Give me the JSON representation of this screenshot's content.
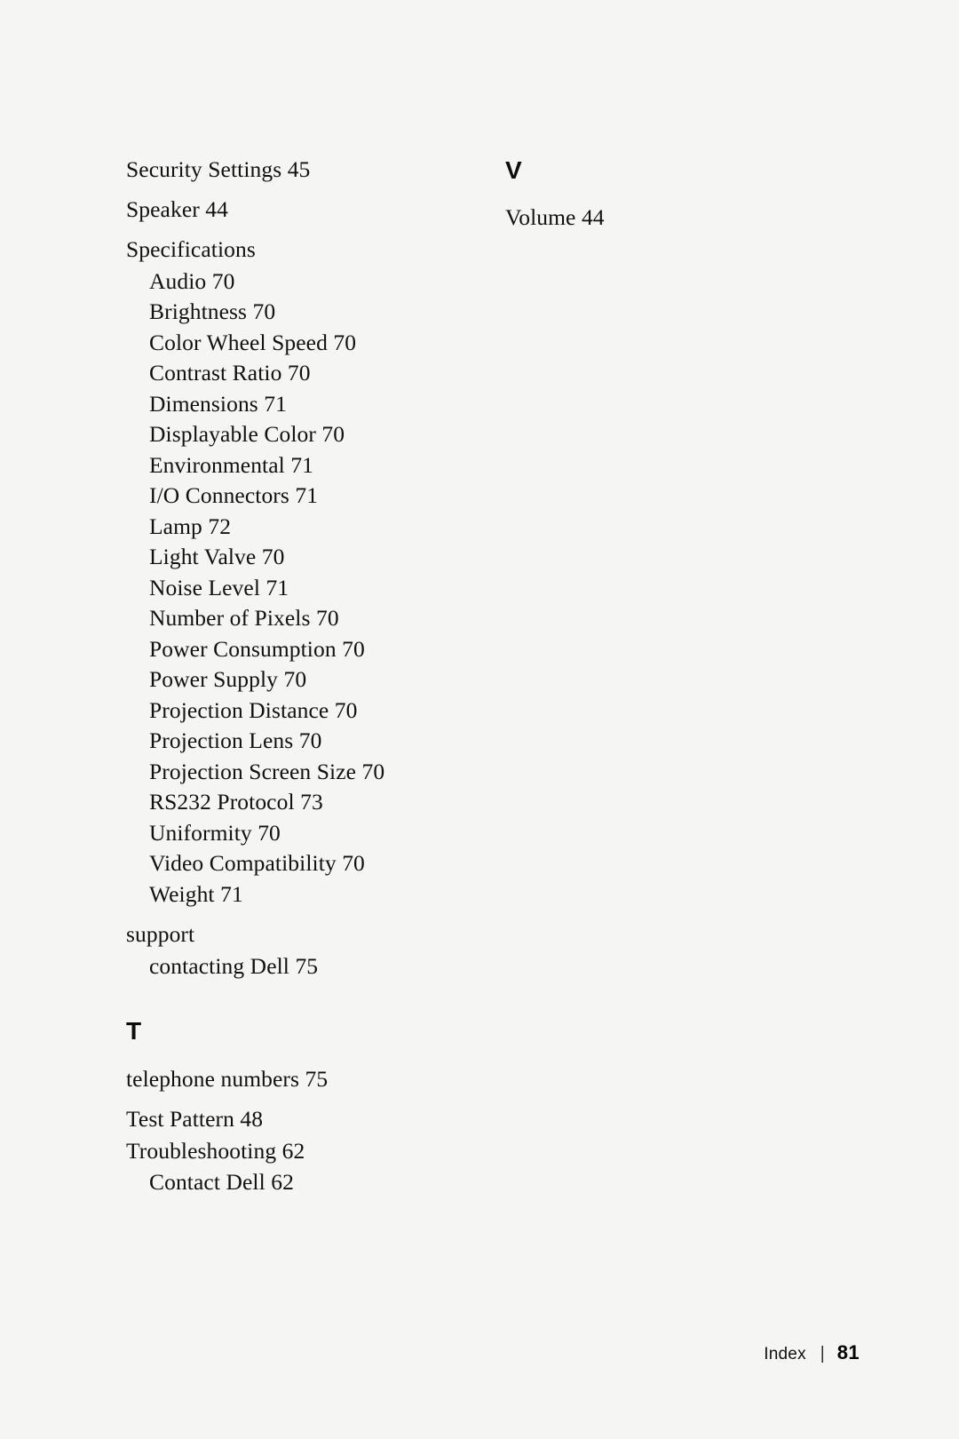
{
  "page": {
    "background_color": "#f5f6f4",
    "text_color": "#111111"
  },
  "columns": {
    "left": {
      "entries": [
        {
          "text": "Security Settings 45",
          "level": 1
        },
        {
          "text": "Speaker 44",
          "level": 1
        },
        {
          "text": "Specifications",
          "level": 1
        },
        {
          "text": "Audio 70",
          "level": 2
        },
        {
          "text": "Brightness 70",
          "level": 2
        },
        {
          "text": "Color Wheel Speed 70",
          "level": 2
        },
        {
          "text": "Contrast Ratio 70",
          "level": 2
        },
        {
          "text": "Dimensions 71",
          "level": 2
        },
        {
          "text": "Displayable Color 70",
          "level": 2
        },
        {
          "text": "Environmental 71",
          "level": 2
        },
        {
          "text": "I/O Connectors 71",
          "level": 2
        },
        {
          "text": "Lamp 72",
          "level": 2
        },
        {
          "text": "Light Valve 70",
          "level": 2
        },
        {
          "text": "Noise Level 71",
          "level": 2
        },
        {
          "text": "Number of Pixels 70",
          "level": 2
        },
        {
          "text": "Power Consumption 70",
          "level": 2
        },
        {
          "text": "Power Supply 70",
          "level": 2
        },
        {
          "text": "Projection Distance 70",
          "level": 2
        },
        {
          "text": "Projection Lens 70",
          "level": 2
        },
        {
          "text": "Projection Screen Size 70",
          "level": 2
        },
        {
          "text": "RS232 Protocol 73",
          "level": 2
        },
        {
          "text": "Uniformity 70",
          "level": 2
        },
        {
          "text": "Video Compatibility 70",
          "level": 2
        },
        {
          "text": "Weight 71",
          "level": 2
        },
        {
          "text": "support",
          "level": 1
        },
        {
          "text": "contacting Dell 75",
          "level": 2
        }
      ],
      "section": {
        "letter": "T",
        "entries": [
          {
            "text": "telephone numbers 75",
            "level": 1
          },
          {
            "text": "Test Pattern 48",
            "level": 1
          },
          {
            "text": "Troubleshooting 62",
            "level": 1
          },
          {
            "text": "Contact Dell 62",
            "level": 2
          }
        ]
      }
    },
    "right": {
      "section": {
        "letter": "V",
        "entries": [
          {
            "text": "Volume 44",
            "level": 1
          }
        ]
      }
    }
  },
  "footer": {
    "label": "Index",
    "separator": "|",
    "page_number": "81"
  }
}
